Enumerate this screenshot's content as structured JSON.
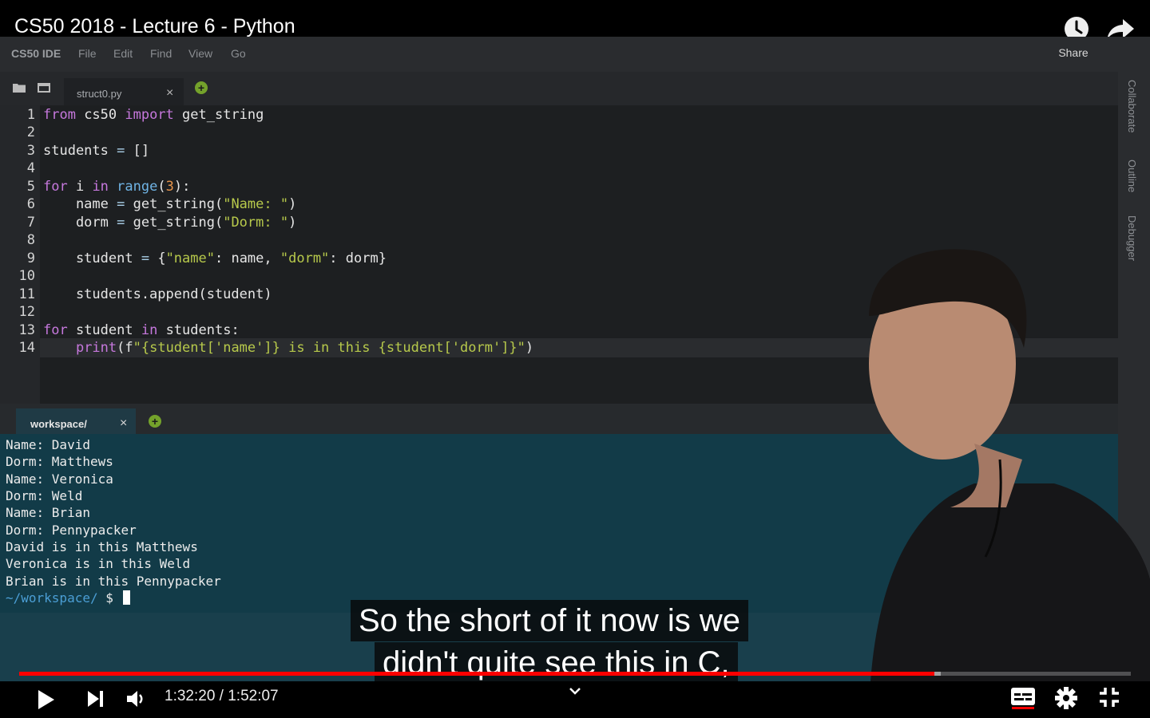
{
  "video": {
    "title": "CS50 2018 - Lecture 6 - Python",
    "share_label": "Share"
  },
  "ide": {
    "logo": "CS50 IDE",
    "menu": [
      "File",
      "Edit",
      "Find",
      "View",
      "Go"
    ],
    "editor_tab": "struct0.py",
    "editor_tab_close": "×",
    "add_tab": "+",
    "side_tabs": [
      "Collaborate",
      "Outline",
      "Debugger"
    ],
    "line_numbers": [
      "1",
      "2",
      "3",
      "4",
      "5",
      "6",
      "7",
      "8",
      "9",
      "10",
      "11",
      "12",
      "13",
      "14"
    ],
    "code": {
      "l1_kw1": "from",
      "l1_mid": " cs50 ",
      "l1_kw2": "import",
      "l1_end": " get_string",
      "l3_a": "students ",
      "l3_op": "=",
      "l3_b": " []",
      "l5_kw1": "for",
      "l5_a": " i ",
      "l5_kw2": "in",
      "l5_fn": " range",
      "l5_p1": "(",
      "l5_num": "3",
      "l5_p2": "):",
      "l6_a": "    name ",
      "l6_op": "=",
      "l6_b": " get_string(",
      "l6_str": "\"Name: \"",
      "l6_c": ")",
      "l7_a": "    dorm ",
      "l7_op": "=",
      "l7_b": " get_string(",
      "l7_str": "\"Dorm: \"",
      "l7_c": ")",
      "l9_a": "    student ",
      "l9_op": "=",
      "l9_b": " {",
      "l9_s1": "\"name\"",
      "l9_c": ": name, ",
      "l9_s2": "\"dorm\"",
      "l9_d": ": dorm}",
      "l11": "    students.append(student)",
      "l13_kw1": "for",
      "l13_a": " student ",
      "l13_kw2": "in",
      "l13_b": " students:",
      "l14_a": "    ",
      "l14_fn": "print",
      "l14_b": "(f",
      "l14_str": "\"{student['name']} is in this {student['dorm']}\"",
      "l14_c": ")"
    },
    "terminal_tab": "workspace/",
    "terminal_tab_close": "×",
    "terminal_lines": [
      "Name: David",
      "Dorm: Matthews",
      "Name: Veronica",
      "Dorm: Weld",
      "Name: Brian",
      "Dorm: Pennypacker",
      "David is in this Matthews",
      "Veronica is in this Weld",
      "Brian is in this Pennypacker"
    ],
    "terminal_prompt": "~/workspace/",
    "terminal_prompt_symbol": " $ "
  },
  "captions": [
    "So the short of it now is we",
    "didn't quite see this in C,"
  ],
  "player": {
    "time": "1:32:20 / 1:52:07",
    "progress_fraction": 0.823,
    "buffered_fraction": 0.829,
    "accent_color": "#ff0000"
  },
  "icons": [
    "watch-later-icon",
    "share-icon",
    "play-icon",
    "next-icon",
    "volume-icon",
    "chevron-down-icon",
    "subtitles-icon",
    "settings-icon",
    "exit-fullscreen-icon",
    "folder-icon"
  ]
}
